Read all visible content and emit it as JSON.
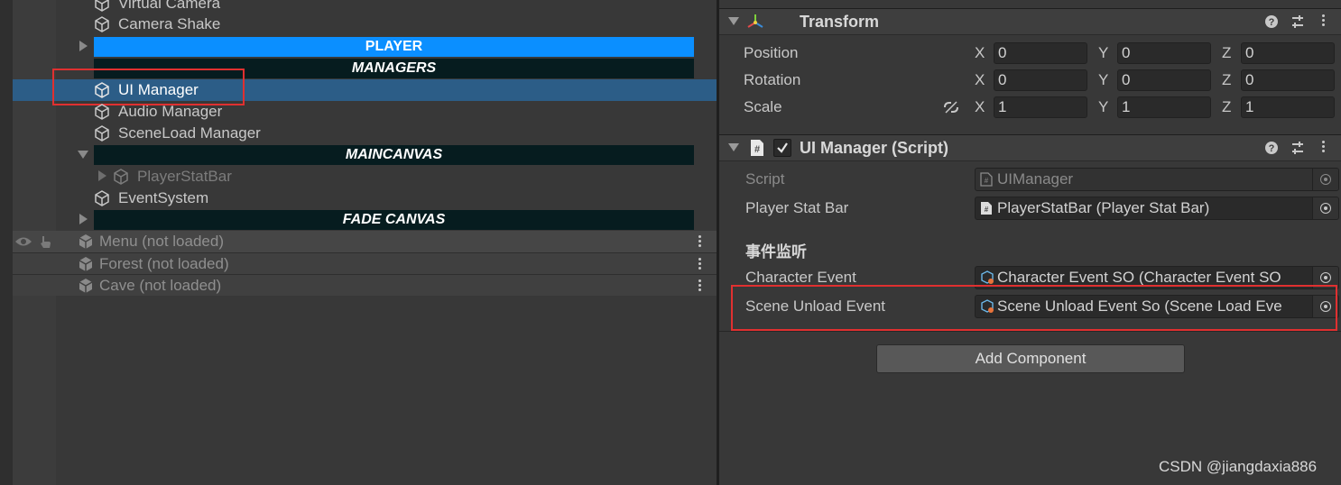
{
  "hierarchy": {
    "items": [
      {
        "label": "Virtual Camera"
      },
      {
        "label": "Camera Shake"
      },
      {
        "label": "UI Manager"
      },
      {
        "label": "Audio Manager"
      },
      {
        "label": "SceneLoad Manager"
      },
      {
        "label": "PlayerStatBar"
      },
      {
        "label": "EventSystem"
      }
    ],
    "headers": {
      "player": "PLAYER",
      "managers": "MANAGERS",
      "maincanvas": "MAINCANVAS",
      "fade_canvas": "FADE CANVAS"
    },
    "scenes": [
      {
        "label": "Menu (not loaded)"
      },
      {
        "label": "Forest (not loaded)"
      },
      {
        "label": "Cave (not loaded)"
      }
    ],
    "header_colors": {
      "player": "#0b8fff",
      "dark": "#061c1f"
    },
    "selection_color": "#2c5d87"
  },
  "inspector": {
    "transform": {
      "title": "Transform",
      "rows": [
        {
          "label": "Position",
          "x": "0",
          "y": "0",
          "z": "0"
        },
        {
          "label": "Rotation",
          "x": "0",
          "y": "0",
          "z": "0"
        },
        {
          "label": "Scale",
          "x": "1",
          "y": "1",
          "z": "1"
        }
      ],
      "axes": {
        "x": "X",
        "y": "Y",
        "z": "Z"
      }
    },
    "script_component": {
      "title": "UI Manager (Script)",
      "enabled": true,
      "fields": {
        "script": {
          "label": "Script",
          "value": "UIManager"
        },
        "player_stat_bar": {
          "label": "Player Stat Bar",
          "value": "PlayerStatBar (Player Stat Bar)"
        },
        "section_header": "事件监听",
        "character_event": {
          "label": "Character Event",
          "value": "Character Event SO (Character Event SO"
        },
        "scene_unload_event": {
          "label": "Scene Unload Event",
          "value": "Scene Unload Event So (Scene Load Eve"
        }
      }
    },
    "add_component_label": "Add Component"
  },
  "watermark": "CSDN @jiangdaxia886",
  "accent_colors": {
    "highlight_box": "#e03030"
  }
}
